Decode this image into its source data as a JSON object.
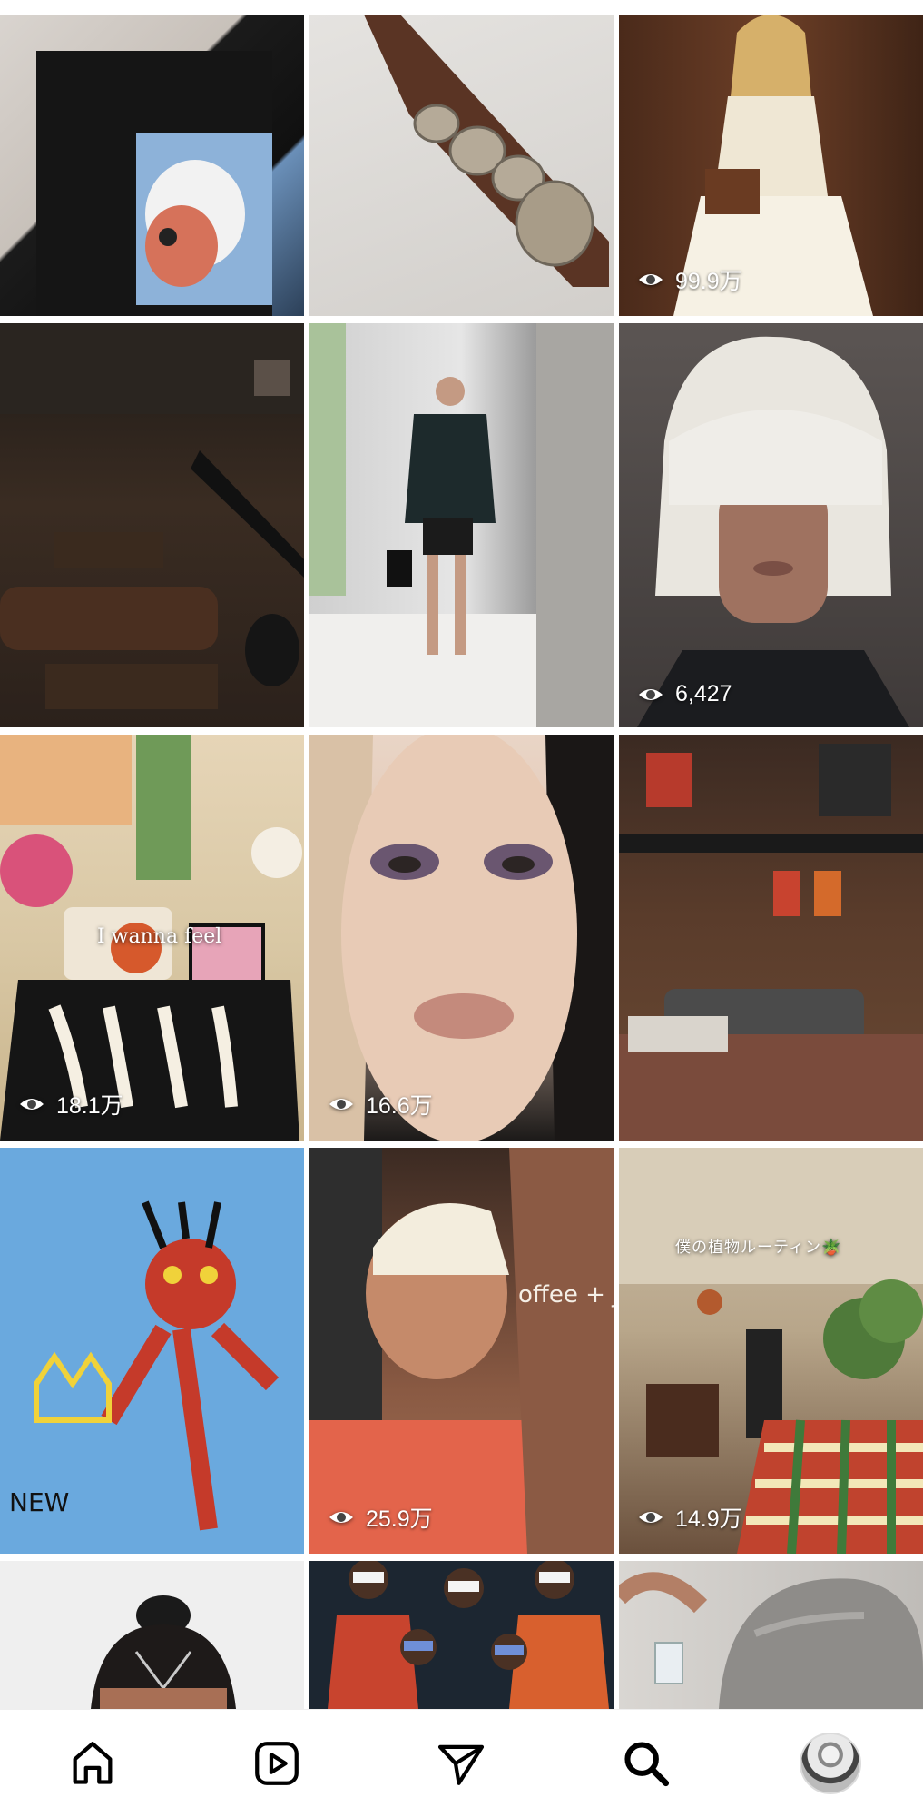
{
  "feed": {
    "tiles": [
      {
        "id": "t1",
        "desc": "graphic-tee",
        "views": ""
      },
      {
        "id": "t2",
        "desc": "silver-bracelets",
        "views": ""
      },
      {
        "id": "t3",
        "desc": "scarf-top-outfit",
        "views": "99.9万"
      },
      {
        "id": "t4",
        "desc": "dark-loft-interior",
        "views": ""
      },
      {
        "id": "t5",
        "desc": "blazer-outfit",
        "views": ""
      },
      {
        "id": "t6",
        "desc": "white-bob-portrait",
        "views": "6,427"
      },
      {
        "id": "t7",
        "desc": "cozy-bedroom",
        "views": "18.1万",
        "caption": "I wanna feel"
      },
      {
        "id": "t8",
        "desc": "makeup-closeup",
        "views": "16.6万"
      },
      {
        "id": "t9",
        "desc": "industrial-loft",
        "views": ""
      },
      {
        "id": "t10",
        "desc": "street-art-painting",
        "views": ""
      },
      {
        "id": "t11",
        "desc": "platinum-pixie-cut",
        "views": "25.9万"
      },
      {
        "id": "t12",
        "desc": "plant-filled-room",
        "views": "14.9万",
        "caption": "僕の植物ルーティン🪴"
      },
      {
        "id": "t13",
        "desc": "braided-updo",
        "views": ""
      },
      {
        "id": "t14",
        "desc": "group-glasses-photo",
        "views": ""
      },
      {
        "id": "t15",
        "desc": "hair-salon",
        "views": ""
      }
    ]
  },
  "nav": {
    "items": [
      "home-icon",
      "reels-icon",
      "messages-icon",
      "search-icon",
      "profile-avatar"
    ],
    "active": "search-icon"
  },
  "colors": {
    "background": "#ffffff",
    "icon": "#000000",
    "overlay_text": "#ffffff"
  }
}
